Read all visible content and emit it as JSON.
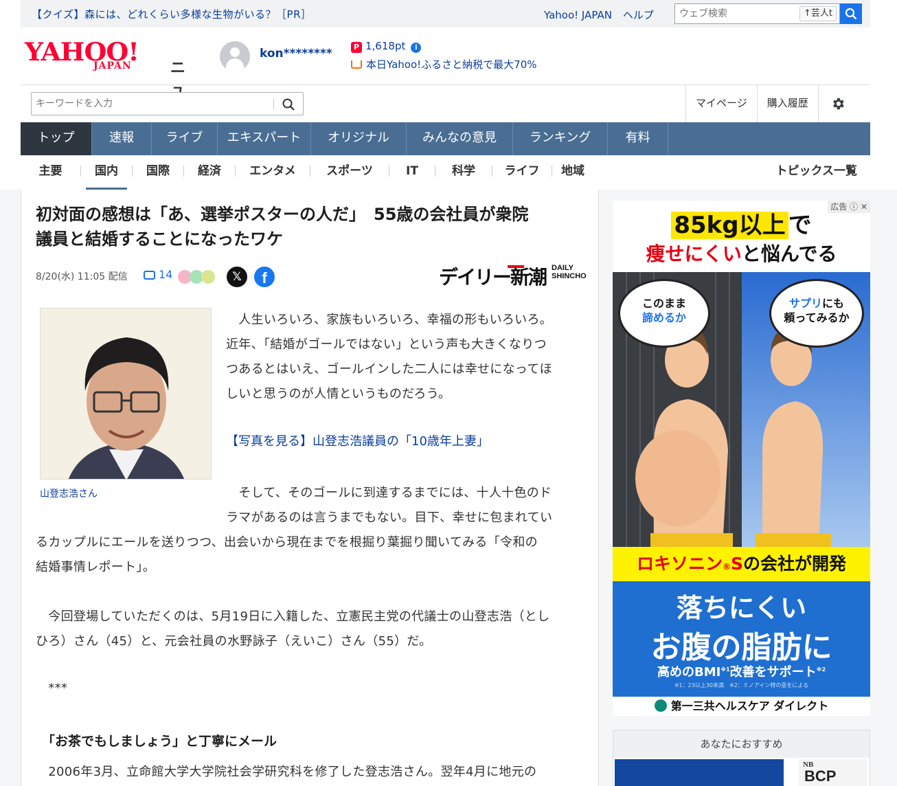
{
  "promo": {
    "text": "【クイズ】森には、どれくらい多様な生物がいる？［PR］"
  },
  "top_links": {
    "yahoo_japan": "Yahoo! JAPAN",
    "help": "ヘルプ"
  },
  "web_search": {
    "placeholder": "ウェブ検索",
    "trend_button": "芸人t"
  },
  "logo": {
    "yahoo": "YAHOO!",
    "japan": "JAPAN",
    "news": "ニュース"
  },
  "user": {
    "name": "kon********",
    "points": "1,618pt",
    "promo": "本日Yahoo!ふるさと納税で最大70%"
  },
  "keyword_search": {
    "placeholder": "キーワードを入力"
  },
  "header_links": {
    "mypage": "マイページ",
    "history": "購入履歴"
  },
  "main_nav": {
    "items": [
      {
        "label": "トップ"
      },
      {
        "label": "速報"
      },
      {
        "label": "ライブ"
      },
      {
        "label": "エキスパート"
      },
      {
        "label": "オリジナル"
      },
      {
        "label": "みんなの意見"
      },
      {
        "label": "ランキング"
      },
      {
        "label": "有料"
      }
    ]
  },
  "sub_nav": {
    "items": [
      {
        "label": "主要"
      },
      {
        "label": "国内"
      },
      {
        "label": "国際"
      },
      {
        "label": "経済"
      },
      {
        "label": "エンタメ"
      },
      {
        "label": "スポーツ"
      },
      {
        "label": "IT"
      },
      {
        "label": "科学"
      },
      {
        "label": "ライフ"
      },
      {
        "label": "地域"
      }
    ],
    "topics": "トピックス一覧"
  },
  "article": {
    "title_line1": "初対面の感想は「あ、選挙ポスターの人だ」　55歳の会社員が衆院",
    "title_line2": "議員と結婚することになったワケ",
    "date": "8/20(水) 11:05 配信",
    "comments": "14",
    "publisher_jp": "デイリー新潮",
    "publisher_en1": "DAILY",
    "publisher_en2": "SHINCHO",
    "photo_caption": "山登志浩さん",
    "p1": [
      "　人生いろいろ、家族もいろいろ、幸福の形もいろいろ。",
      "近年、「結婚がゴールではない」という声も大きくなりつ",
      "つあるとはいえ、ゴールインした二人には幸せになってほ",
      "しいと思うのが人情というものだろう。"
    ],
    "photo_link": "【写真を見る】山登志浩議員の「10歳年上妻」",
    "p2_right": [
      "　そして、そのゴールに到達するまでには、十人十色のド",
      "ラマがあるのは言うまでもない。目下、幸せに包まれてい"
    ],
    "p2_full": [
      "るカップルにエールを送りつつ、出会いから現在までを根掘り葉掘り聞いてみる「令和の",
      "結婚事情レポート」。"
    ],
    "p3": [
      "　今回登場していただくのは、5月19日に入籍した、立憲民主党の代議士の山登志浩（とし",
      "ひろ）さん（45）と、元会社員の水野詠子（えいこ）さん（55）だ。"
    ],
    "stars": "　***",
    "subhead": "「お茶でもしましょう」と丁寧にメール",
    "p4": "　2006年3月、立命館大学大学院社会学研究科を修了した登志浩さん。翌年4月に地元の"
  },
  "ad": {
    "label": "広告",
    "headline1_hl": "85kg以上",
    "headline1_rest": "で",
    "headline2_red": "痩せにくい",
    "headline2_rest": "と悩んでる",
    "bubble_left_1": "このまま",
    "bubble_left_2": "諦めるか",
    "bubble_right_1a": "サプリ",
    "bubble_right_1b": "にも",
    "bubble_right_2": "頼ってみるか",
    "band_red": "ロキソニン",
    "band_reg": "®",
    "band_s": "S",
    "band_rest": "の会社が開発",
    "blue_l1": "落ちにくい",
    "blue_l2": "お腹の脂肪に",
    "blue_l3a": "高めのBMI",
    "blue_l3b": "※1",
    "blue_l3c": "改善をサポート",
    "blue_l3d": "※2",
    "blue_l4": "※1：23以上30未満　※2：ミノアイン特の意をによる",
    "footer": "第一三共ヘルスケア ダイレクト"
  },
  "recommend": {
    "title": "あなたにおすすめ",
    "thumb_nb": "NB",
    "thumb_bcp": "BCP"
  },
  "colors": {
    "nav_bg": "#4a6e93",
    "nav_active": "#2e3640",
    "link_blue": "#0a3d9b",
    "yahoo_red": "#ff0033"
  }
}
